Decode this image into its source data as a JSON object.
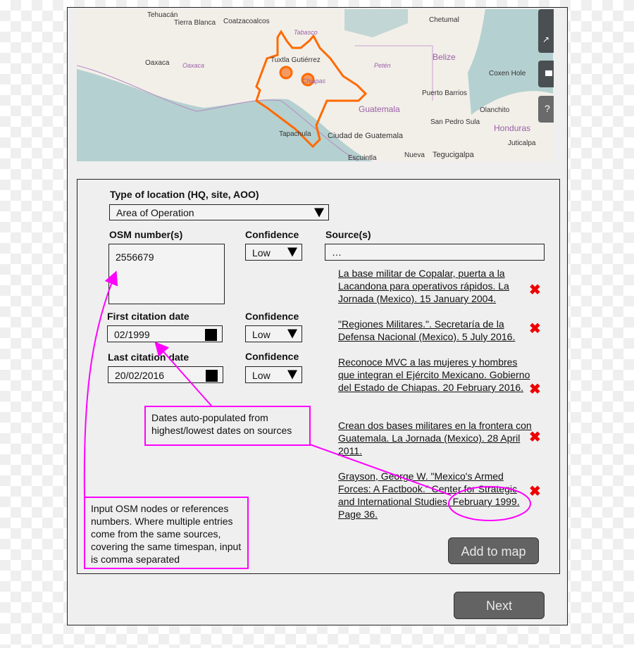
{
  "map": {
    "labels": [
      "Tehuacán",
      "Tierra Blanca",
      "Coatzacoalcos",
      "Tabasco",
      "Chetumal",
      "Oaxaca",
      "Oaxaca",
      "Tuxtla Gutiérrez",
      "Chiapas",
      "Petén",
      "Belize",
      "Coxen Hole",
      "Puerto Barrios",
      "Guatemala",
      "Olanchito",
      "San Pedro Sula",
      "Honduras",
      "Tapachula",
      "Ciudad de Guatemala",
      "Juticalpa",
      "Nueva",
      "Tegucigalpa",
      "Escuintla"
    ],
    "highlight_color": "#ff6a00",
    "icons": [
      "share-icon",
      "comment-icon",
      "help-icon"
    ]
  },
  "form": {
    "location_type_label": "Type of location (HQ, site, AOO)",
    "location_type_value": "Area of Operation",
    "osm_label": "OSM number(s)",
    "osm_value": "2556679",
    "confidence_label": "Confidence",
    "osm_confidence": "Low",
    "sources_label": "Source(s)",
    "sources_value": "…",
    "first_date_label": "First citation date",
    "first_date_value": "02/1999",
    "first_confidence": "Low",
    "last_date_label": "Last citation date",
    "last_date_value": "20/02/2016",
    "last_confidence": "Low",
    "sources": [
      "La base militar de Copalar, puerta a la Lacandona para operativos rápidos. La Jornada (Mexico). 15 January 2004.",
      "\"Regiones Militares.\". Secretaría de la Defensa Nacional (Mexico). 5 July 2016.",
      "Reconoce MVC a las mujeres y hombres que integran el Ejército Mexicano. Gobierno del Estado de Chiapas. 20 February 2016.",
      "Crean dos bases militares en la frontera con Guatemala. La Jornada (Mexico). 28 April 2011.",
      "Grayson, George W. \"Mexico's Armed Forces: A Factbook.\" Center for Strategic and International Studies. February 1999. Page 36."
    ],
    "remove_icon": "✖",
    "add_button": "Add to map"
  },
  "next_button": "Next",
  "annotations": {
    "color": "#ff00ff",
    "dates_note": "Dates auto-populated from highest/lowest dates on sources",
    "osm_note": "Input OSM nodes or references numbers. Where multiple entries come from the same sources, covering the same timespan, input is comma separated"
  }
}
